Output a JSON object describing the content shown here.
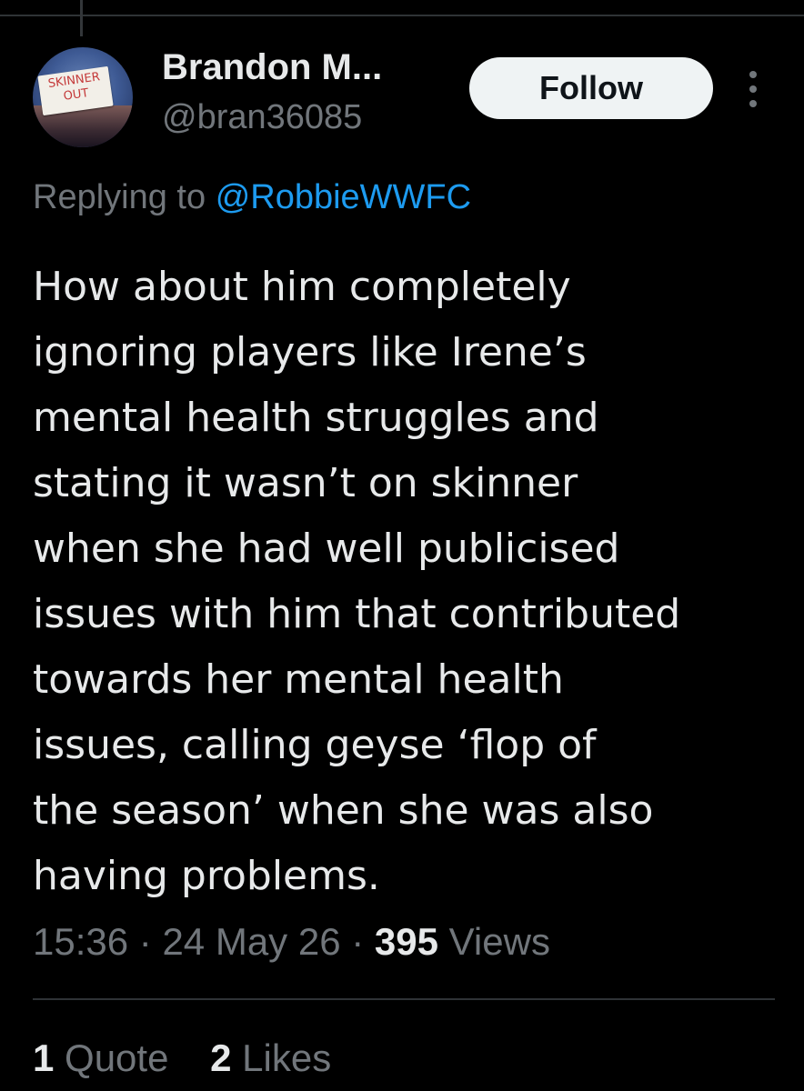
{
  "tweet": {
    "author": {
      "display_name": "Brandon M...",
      "handle": "@bran36085",
      "avatar_sign_line1": "SKINNER",
      "avatar_sign_line2": "OUT"
    },
    "follow_label": "Follow",
    "more_icon": "more-vertical-icon",
    "replying_prefix": "Replying to",
    "replying_to": "@RobbieWWFC",
    "text_lines": [
      "How about him completely",
      "ignoring players like Irene’s",
      "mental health struggles and",
      "stating it wasn’t on skinner",
      "when she had well publicised",
      "issues with him that contributed",
      "towards her mental health",
      "issues, calling geyse ‘flop of",
      "the season’ when she was also",
      "having problems."
    ],
    "time": "15:36",
    "date": "24 May 26",
    "views_count": "395",
    "views_label": "Views",
    "separator": "·",
    "quotes_count": "1",
    "quotes_label": "Quote",
    "likes_count": "2",
    "likes_label": "Likes"
  },
  "colors": {
    "background": "#000000",
    "text_primary": "#e7e9ea",
    "text_secondary": "#71767b",
    "link": "#1d9bf0",
    "divider": "#2f3336",
    "follow_button_bg": "#eff3f4"
  }
}
